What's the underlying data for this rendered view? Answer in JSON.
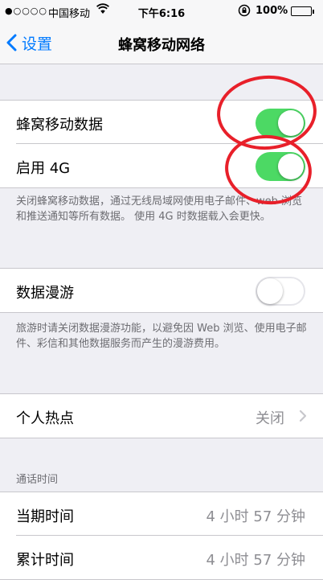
{
  "status_bar": {
    "signal": "●○○○○",
    "carrier": "中国移动",
    "time": "下午6:16",
    "battery": "100%"
  },
  "nav": {
    "back_label": "设置",
    "title": "蜂窝移动网络"
  },
  "cellular": {
    "data_label": "蜂窝移动数据",
    "data_on": true,
    "lte_label": "启用 4G",
    "lte_on": true,
    "footnote": "关闭蜂窝移动数据，通过无线局域网使用电子邮件、web 浏览和推送通知等所有数据。 使用 4G 时数据载入会更快。"
  },
  "roaming": {
    "label": "数据漫游",
    "on": false,
    "footnote": "旅游时请关闭数据漫游功能，以避免因 Web 浏览、使用电子邮件、彩信和其他数据服务而产生的漫游费用。"
  },
  "hotspot": {
    "label": "个人热点",
    "value": "关闭"
  },
  "call_time": {
    "header": "通话时间",
    "current_label": "当期时间",
    "current_value": "4 小时 57 分钟",
    "lifetime_label": "累计时间",
    "lifetime_value": "4 小时 57 分钟"
  },
  "colors": {
    "accent": "#007aff",
    "toggle_on": "#4cd964",
    "annotation": "#e8202a"
  }
}
